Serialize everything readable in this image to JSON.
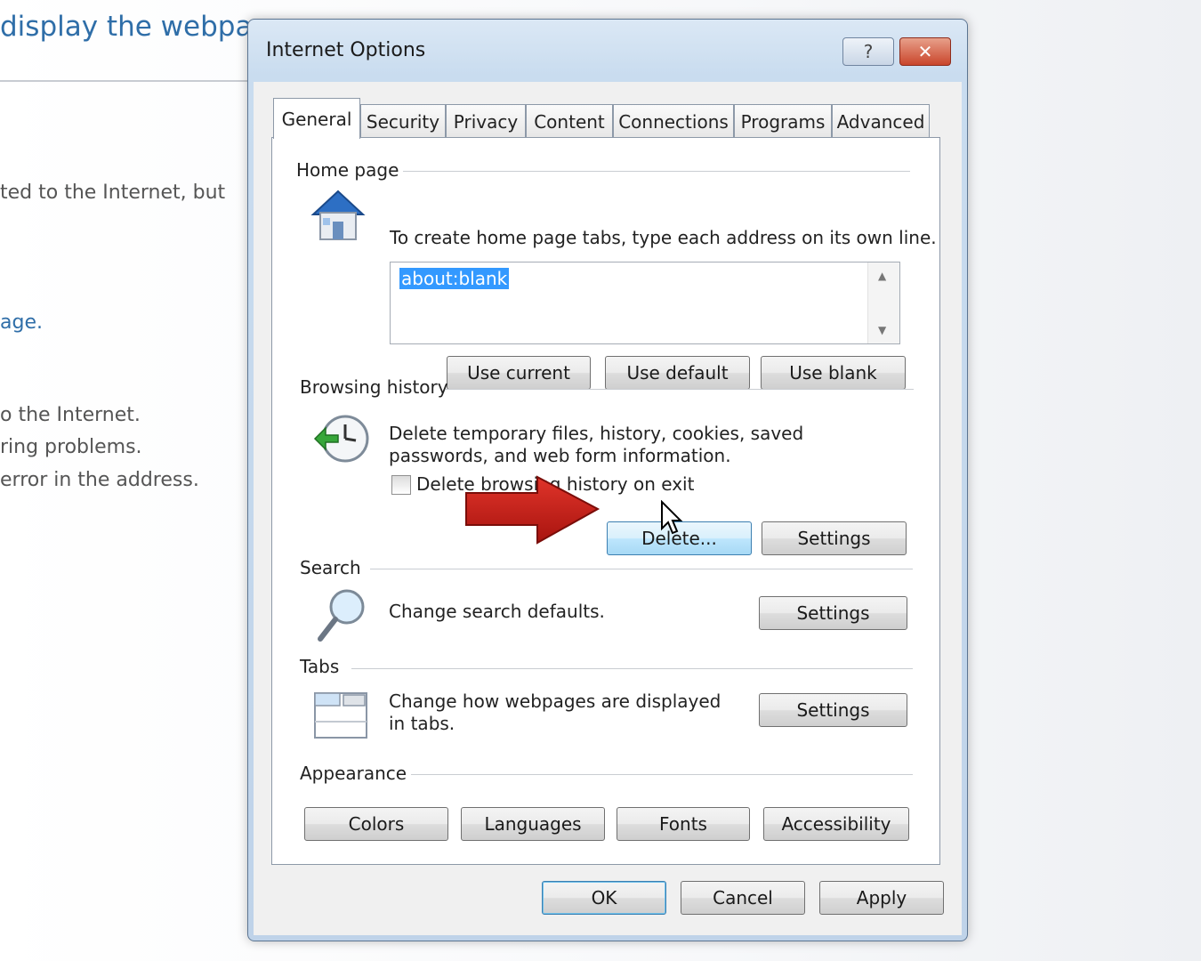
{
  "background_page": {
    "title": "display the webpag",
    "lines": [
      "ted to the Internet, but",
      "age.",
      "o the Internet.",
      "ring problems.",
      "error in the address."
    ]
  },
  "dialog": {
    "title": "Internet Options",
    "help_glyph": "?",
    "close_glyph": "✕",
    "tabs": [
      "General",
      "Security",
      "Privacy",
      "Content",
      "Connections",
      "Programs",
      "Advanced"
    ],
    "active_tab": "General",
    "home_page": {
      "label": "Home page",
      "description": "To create home page tabs, type each address on its own line.",
      "value": "about:blank",
      "buttons": [
        "Use current",
        "Use default",
        "Use blank"
      ]
    },
    "browsing_history": {
      "label": "Browsing history",
      "description": "Delete temporary files, history, cookies, saved passwords, and web form information.",
      "checkbox_label": "Delete browsing history on exit",
      "checkbox_checked": false,
      "delete_button": "Delete...",
      "settings_button": "Settings"
    },
    "search": {
      "label": "Search",
      "description": "Change search defaults.",
      "settings_button": "Settings"
    },
    "tabs_section": {
      "label": "Tabs",
      "description": "Change how webpages are displayed in tabs.",
      "settings_button": "Settings"
    },
    "appearance": {
      "label": "Appearance",
      "buttons": [
        "Colors",
        "Languages",
        "Fonts",
        "Accessibility"
      ]
    },
    "footer": {
      "ok": "OK",
      "cancel": "Cancel",
      "apply": "Apply"
    }
  },
  "colors": {
    "link_blue": "#2f6ea8",
    "selection_blue": "#3399ff",
    "arrow_red": "#c8201a"
  }
}
